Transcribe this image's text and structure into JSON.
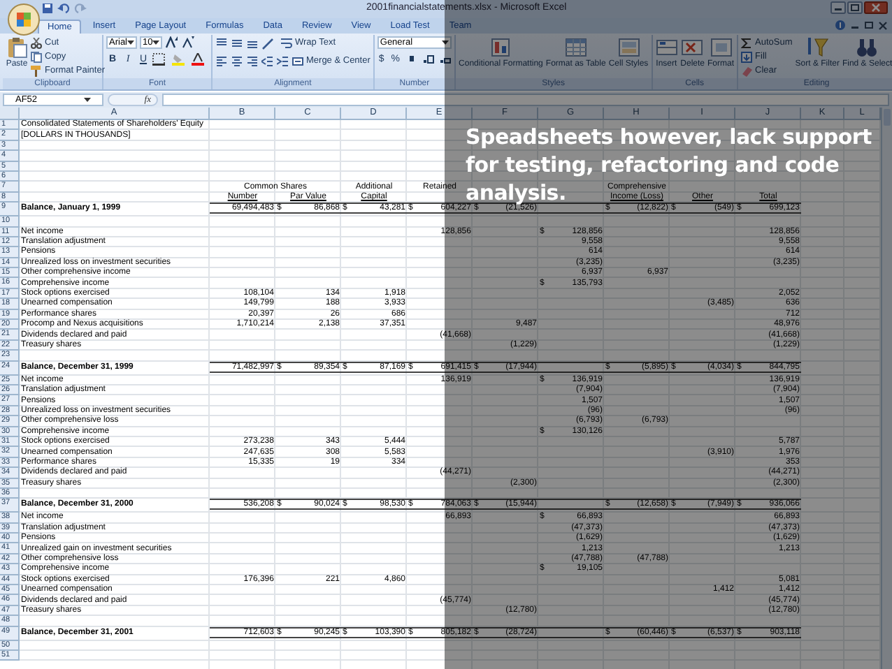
{
  "window": {
    "title": "2001financialstatements.xlsx - Microsoft Excel"
  },
  "tabs": [
    {
      "label": "Home",
      "selected": true
    },
    {
      "label": "Insert",
      "selected": false
    },
    {
      "label": "Page Layout",
      "selected": false
    },
    {
      "label": "Formulas",
      "selected": false
    },
    {
      "label": "Data",
      "selected": false
    },
    {
      "label": "Review",
      "selected": false
    },
    {
      "label": "View",
      "selected": false
    },
    {
      "label": "Load Test",
      "selected": false
    },
    {
      "label": "Team",
      "selected": false
    }
  ],
  "ribbon": {
    "clipboard": {
      "label": "Clipboard",
      "paste": "Paste",
      "cut": "Cut",
      "copy": "Copy",
      "format_painter": "Format Painter"
    },
    "font": {
      "label": "Font",
      "font_name": "Arial",
      "font_size": "10",
      "bold": "B",
      "italic": "I",
      "underline": "U"
    },
    "alignment": {
      "label": "Alignment",
      "wrap_text": "Wrap Text",
      "merge_center": "Merge & Center"
    },
    "number": {
      "label": "Number",
      "format": "General",
      "currency": "$",
      "percent": "%"
    },
    "styles": {
      "label": "Styles",
      "conditional_formatting": "Conditional Formatting",
      "format_as_table": "Format as Table",
      "cell_styles": "Cell Styles"
    },
    "cells": {
      "label": "Cells",
      "insert": "Insert",
      "delete": "Delete",
      "format": "Format"
    },
    "editing": {
      "label": "Editing",
      "autosum": "AutoSum",
      "fill": "Fill",
      "clear": "Clear",
      "sort_filter": "Sort & Filter",
      "find_select": "Find & Select"
    }
  },
  "formula_bar": {
    "name_box": "AF52",
    "fx": "fx"
  },
  "sheet": {
    "columns": [
      "A",
      "B",
      "C",
      "D",
      "E",
      "F",
      "G",
      "H",
      "I",
      "J",
      "K",
      "L"
    ],
    "rows": [
      {
        "n": "1",
        "kind": "normal",
        "label": "Consolidated Statements of Shareholders' Equity",
        "cells": {}
      },
      {
        "n": "2",
        "kind": "note",
        "label": "[DOLLARS IN THOUSANDS]",
        "cells": {}
      },
      {
        "n": "3",
        "kind": "normal",
        "cells": {}
      },
      {
        "n": "4",
        "kind": "normal",
        "cells": {}
      },
      {
        "n": "5",
        "kind": "normal",
        "cells": {}
      },
      {
        "n": "6",
        "kind": "normal",
        "cells": {}
      },
      {
        "n": "7",
        "kind": "header",
        "cells": {
          "B": {
            "kind": "spanning",
            "text": "Common Shares"
          },
          "D": "Additional",
          "E": "Retained",
          "H": "Comprehensive"
        }
      },
      {
        "n": "8",
        "kind": "column_titles",
        "cells": {
          "B": "Number",
          "C": "Par Value",
          "D": "Capital",
          "H": "Income (Loss)",
          "I": "Other",
          "J": "Total"
        }
      },
      {
        "n": "9",
        "kind": "balance",
        "label": "Balance, January 1, 1999",
        "cells": {
          "B": "69,494,483",
          "C": {
            "currency": "$",
            "text": "86,868"
          },
          "D": {
            "currency": "$",
            "text": "43,281"
          },
          "E": {
            "currency": "$",
            "text": "604,227"
          },
          "F": {
            "currency": "$",
            "text": "(21,526)"
          },
          "H": {
            "currency": "$",
            "text": "(12,822)"
          },
          "I": {
            "currency": "$",
            "text": "(549)"
          },
          "J": {
            "currency": "$",
            "text": "699,123"
          }
        }
      },
      {
        "n": "10",
        "kind": "normal",
        "cells": {}
      },
      {
        "n": "11",
        "kind": "normal",
        "label": "Net income",
        "cells": {
          "E": "128,856",
          "G": {
            "currency": "$",
            "text": "128,856"
          },
          "J": "128,856"
        }
      },
      {
        "n": "12",
        "kind": "normal",
        "label": "Translation adjustment",
        "cells": {
          "G": "9,558",
          "J": "9,558"
        }
      },
      {
        "n": "13",
        "kind": "normal",
        "label": "Pensions",
        "cells": {
          "G": "614",
          "J": "614"
        }
      },
      {
        "n": "14",
        "kind": "normal",
        "label": "Unrealized loss on investment securities",
        "cells": {
          "G": "(3,235)",
          "J": "(3,235)"
        }
      },
      {
        "n": "15",
        "kind": "normal",
        "label": "Other comprehensive income",
        "cells": {
          "G": "6,937",
          "H": "6,937"
        }
      },
      {
        "n": "16",
        "kind": "normal",
        "label": "Comprehensive income",
        "cells": {
          "G": {
            "currency": "$",
            "text": "135,793"
          }
        }
      },
      {
        "n": "17",
        "kind": "normal",
        "label": "Stock options exercised",
        "cells": {
          "B": "108,104",
          "C": "134",
          "D": "1,918",
          "J": "2,052"
        }
      },
      {
        "n": "18",
        "kind": "normal",
        "label": "Unearned compensation",
        "cells": {
          "B": "149,799",
          "C": "188",
          "D": "3,933",
          "I": "(3,485)",
          "J": "636"
        }
      },
      {
        "n": "19",
        "kind": "normal",
        "label": "Performance shares",
        "cells": {
          "B": "20,397",
          "C": "26",
          "D": "686",
          "J": "712"
        }
      },
      {
        "n": "20",
        "kind": "normal",
        "label": "Procomp and Nexus acquisitions",
        "cells": {
          "B": "1,710,214",
          "C": "2,138",
          "D": "37,351",
          "F": "9,487",
          "J": "48,976"
        }
      },
      {
        "n": "21",
        "kind": "normal",
        "label": "Dividends declared and paid",
        "cells": {
          "E": "(41,668)",
          "J": "(41,668)"
        }
      },
      {
        "n": "22",
        "kind": "normal",
        "label": "Treasury shares",
        "cells": {
          "F": "(1,229)",
          "J": "(1,229)"
        }
      },
      {
        "n": "23",
        "kind": "normal",
        "cells": {}
      },
      {
        "n": "24",
        "kind": "balance",
        "label": "Balance, December 31, 1999",
        "cells": {
          "B": "71,482,997",
          "C": {
            "currency": "$",
            "text": "89,354"
          },
          "D": {
            "currency": "$",
            "text": "87,169"
          },
          "E": {
            "currency": "$",
            "text": "691,415"
          },
          "F": {
            "currency": "$",
            "text": "(17,944)"
          },
          "H": {
            "currency": "$",
            "text": "(5,895)"
          },
          "I": {
            "currency": "$",
            "text": "(4,034)"
          },
          "J": {
            "currency": "$",
            "text": "844,795"
          }
        }
      },
      {
        "n": "25",
        "kind": "normal",
        "label": "Net income",
        "cells": {
          "E": "136,919",
          "G": {
            "currency": "$",
            "text": "136,919"
          },
          "J": "136,919"
        }
      },
      {
        "n": "26",
        "kind": "normal",
        "label": "Translation adjustment",
        "cells": {
          "G": "(7,904)",
          "J": "(7,904)"
        }
      },
      {
        "n": "27",
        "kind": "normal",
        "label": "Pensions",
        "cells": {
          "G": "1,507",
          "J": "1,507"
        }
      },
      {
        "n": "28",
        "kind": "normal",
        "label": "Unrealized loss on investment securities",
        "cells": {
          "G": "(96)",
          "J": "(96)"
        }
      },
      {
        "n": "29",
        "kind": "normal",
        "label": "Other comprehensive loss",
        "cells": {
          "G": "(6,793)",
          "H": "(6,793)"
        }
      },
      {
        "n": "30",
        "kind": "normal",
        "label": "Comprehensive income",
        "cells": {
          "G": {
            "currency": "$",
            "text": "130,126"
          }
        }
      },
      {
        "n": "31",
        "kind": "normal",
        "label": "Stock options exercised",
        "cells": {
          "B": "273,238",
          "C": "343",
          "D": "5,444",
          "J": "5,787"
        }
      },
      {
        "n": "32",
        "kind": "normal",
        "label": "Unearned compensation",
        "cells": {
          "B": "247,635",
          "C": "308",
          "D": "5,583",
          "I": "(3,910)",
          "J": "1,976"
        }
      },
      {
        "n": "33",
        "kind": "normal",
        "label": "Performance shares",
        "cells": {
          "B": "15,335",
          "C": "19",
          "D": "334",
          "J": "353"
        }
      },
      {
        "n": "34",
        "kind": "normal",
        "label": "Dividends declared and paid",
        "cells": {
          "E": "(44,271)",
          "J": "(44,271)"
        }
      },
      {
        "n": "35",
        "kind": "normal",
        "label": "Treasury shares",
        "cells": {
          "F": "(2,300)",
          "J": "(2,300)"
        }
      },
      {
        "n": "36",
        "kind": "normal",
        "cells": {}
      },
      {
        "n": "37",
        "kind": "balance",
        "label": "Balance, December 31, 2000",
        "cells": {
          "B": "536,208",
          "C": {
            "currency": "$",
            "text": "90,024"
          },
          "D": {
            "currency": "$",
            "text": "98,530"
          },
          "E": {
            "currency": "$",
            "text": "784,063"
          },
          "F": {
            "currency": "$",
            "text": "(15,944)"
          },
          "H": {
            "currency": "$",
            "text": "(12,658)"
          },
          "I": {
            "currency": "$",
            "text": "(7,949)"
          },
          "J": {
            "currency": "$",
            "text": "936,066"
          }
        }
      },
      {
        "n": "38",
        "kind": "normal",
        "label": "Net income",
        "cells": {
          "E": "66,893",
          "G": {
            "currency": "$",
            "text": "66,893"
          },
          "J": "66,893"
        }
      },
      {
        "n": "39",
        "kind": "normal",
        "label": "Translation adjustment",
        "cells": {
          "G": "(47,373)",
          "J": "(47,373)"
        }
      },
      {
        "n": "40",
        "kind": "normal",
        "label": "Pensions",
        "cells": {
          "G": "(1,629)",
          "J": "(1,629)"
        }
      },
      {
        "n": "41",
        "kind": "normal",
        "label": "Unrealized gain on investment securities",
        "cells": {
          "G": "1,213",
          "J": "1,213"
        }
      },
      {
        "n": "42",
        "kind": "normal",
        "label": "Other comprehensive loss",
        "cells": {
          "G": "(47,788)",
          "H": "(47,788)"
        }
      },
      {
        "n": "43",
        "kind": "normal",
        "label": "Comprehensive income",
        "cells": {
          "G": {
            "currency": "$",
            "text": "19,105"
          }
        }
      },
      {
        "n": "44",
        "kind": "normal",
        "label": "Stock options exercised",
        "cells": {
          "B": "176,396",
          "C": "221",
          "D": "4,860",
          "J": "5,081"
        }
      },
      {
        "n": "45",
        "kind": "normal",
        "label": "Unearned compensation",
        "cells": {
          "I": "1,412",
          "J": "1,412"
        }
      },
      {
        "n": "46",
        "kind": "normal",
        "label": "Dividends declared and paid",
        "cells": {
          "E": "(45,774)",
          "J": "(45,774)"
        }
      },
      {
        "n": "47",
        "kind": "normal",
        "label": "Treasury shares",
        "cells": {
          "F": "(12,780)",
          "J": "(12,780)"
        }
      },
      {
        "n": "48",
        "kind": "normal",
        "cells": {}
      },
      {
        "n": "49",
        "kind": "balance",
        "label": "Balance, December 31, 2001",
        "cells": {
          "B": "712,603",
          "C": {
            "currency": "$",
            "text": "90,245"
          },
          "D": {
            "currency": "$",
            "text": "103,390"
          },
          "E": {
            "currency": "$",
            "text": "805,182"
          },
          "F": {
            "currency": "$",
            "text": "(28,724)"
          },
          "H": {
            "currency": "$",
            "text": "(60,446)"
          },
          "I": {
            "currency": "$",
            "text": "(6,537)"
          },
          "J": {
            "currency": "$",
            "text": "903,118"
          }
        }
      },
      {
        "n": "50",
        "kind": "normal",
        "cells": {}
      },
      {
        "n": "51",
        "kind": "normal",
        "cells": {}
      }
    ]
  },
  "caption_lines": [
    "Speadsheets however, lack support",
    "for testing, refactoring and code",
    "analysis."
  ]
}
